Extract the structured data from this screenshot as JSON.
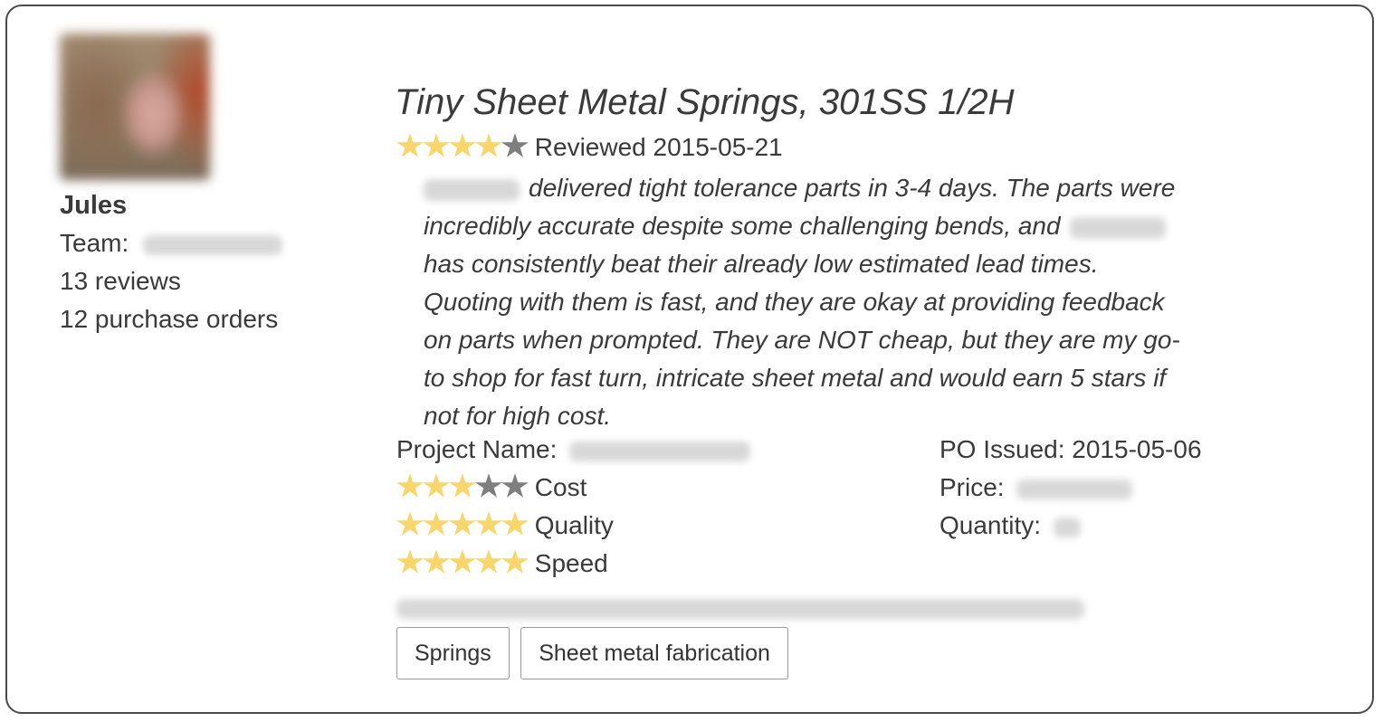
{
  "reviewer": {
    "name": "Jules",
    "team_label": "Team:",
    "reviews": "13 reviews",
    "purchase_orders": "12 purchase orders"
  },
  "review": {
    "title": "Tiny Sheet Metal Springs, 301SS 1/2H",
    "overall_rating": 4,
    "overall_max": 5,
    "reviewed_label": "Reviewed 2015-05-21",
    "body_lines": [
      "delivered tight tolerance parts in 3-4 days. The parts were",
      "incredibly accurate despite some challenging bends, and",
      "has consistently beat their already low estimated lead times.",
      "Quoting with them is fast, and they are okay at providing feedback",
      "on parts when prompted. They are NOT cheap, but they are my go-",
      "to shop for fast turn, intricate sheet metal and would earn 5 stars if",
      "not for high cost."
    ]
  },
  "details": {
    "project_name_label": "Project Name:",
    "po_issued": "PO Issued: 2015-05-06",
    "price_label": "Price:",
    "quantity_label": "Quantity:"
  },
  "sub_ratings": [
    {
      "label": "Cost",
      "rating": 3,
      "max": 5
    },
    {
      "label": "Quality",
      "rating": 5,
      "max": 5
    },
    {
      "label": "Speed",
      "rating": 5,
      "max": 5
    }
  ],
  "tags": [
    "Springs",
    "Sheet metal fabrication"
  ],
  "colors": {
    "star_on": "#f8d66b",
    "star_off": "#7e7e7e",
    "border": "#4a4a4a",
    "text": "#3a3a3a"
  }
}
